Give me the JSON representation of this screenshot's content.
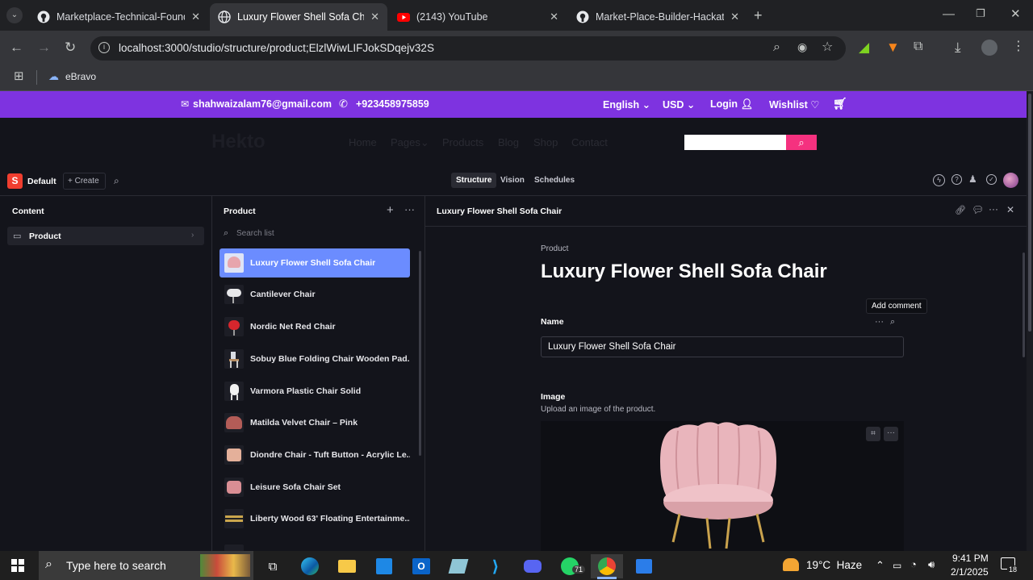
{
  "browser": {
    "tabs": [
      {
        "title": "Marketplace-Technical-Foundat",
        "icon": "github-icon"
      },
      {
        "title": "Luxury Flower Shell Sofa Chair |",
        "icon": "globe-icon"
      },
      {
        "title": "(2143) YouTube",
        "icon": "youtube-icon"
      },
      {
        "title": "Market-Place-Builder-Hackatho",
        "icon": "github-icon"
      }
    ],
    "url_host": "localhost:",
    "url_path": "3000/studio/structure/product;ElzlWiwLIFJokSDqejv32S",
    "bookmark": "eBravo"
  },
  "site": {
    "email": "shahwaizalam76@gmail.com",
    "phone": "+923458975859",
    "language": "English",
    "currency": "USD",
    "login": "Login",
    "wishlist": "Wishlist",
    "logo": "Hekto",
    "nav": [
      "Home",
      "Pages",
      "Products",
      "Blog",
      "Shop",
      "Contact"
    ]
  },
  "studio": {
    "workspace": "Default",
    "create": "Create",
    "tools": [
      "Structure",
      "Vision",
      "Schedules"
    ],
    "content_header": "Content",
    "content_item": "Product",
    "list_header": "Product",
    "search_placeholder": "Search list",
    "products": [
      "Luxury Flower Shell Sofa Chair",
      "Cantilever Chair",
      "Nordic Net Red Chair",
      "Sobuy Blue Folding Chair Wooden Pad...",
      "Varmora Plastic Chair Solid",
      "Matilda Velvet Chair – Pink",
      "Diondre Chair - Tuft Button - Acrylic Le...",
      "Leisure Sofa Chair Set",
      "Liberty Wood 63' Floating Entertainme..."
    ],
    "doc_header": "Luxury Flower Shell Sofa Chair",
    "doc_type": "Product",
    "doc_title": "Luxury Flower Shell Sofa Chair",
    "tooltip": "Add comment",
    "name_label": "Name",
    "name_value": "Luxury Flower Shell Sofa Chair",
    "image_label": "Image",
    "image_desc": "Upload an image of the product."
  },
  "taskbar": {
    "search": "Type here to search",
    "whatsapp_badge": "71",
    "weather": "19°C  Haze",
    "time": "9:41 PM",
    "date": "2/1/2025",
    "notifications": "18"
  },
  "colors": {
    "accent": "#7e33e0",
    "selected": "#6b8cff",
    "pink": "#f5317f",
    "logo_red": "#f03e2f"
  }
}
